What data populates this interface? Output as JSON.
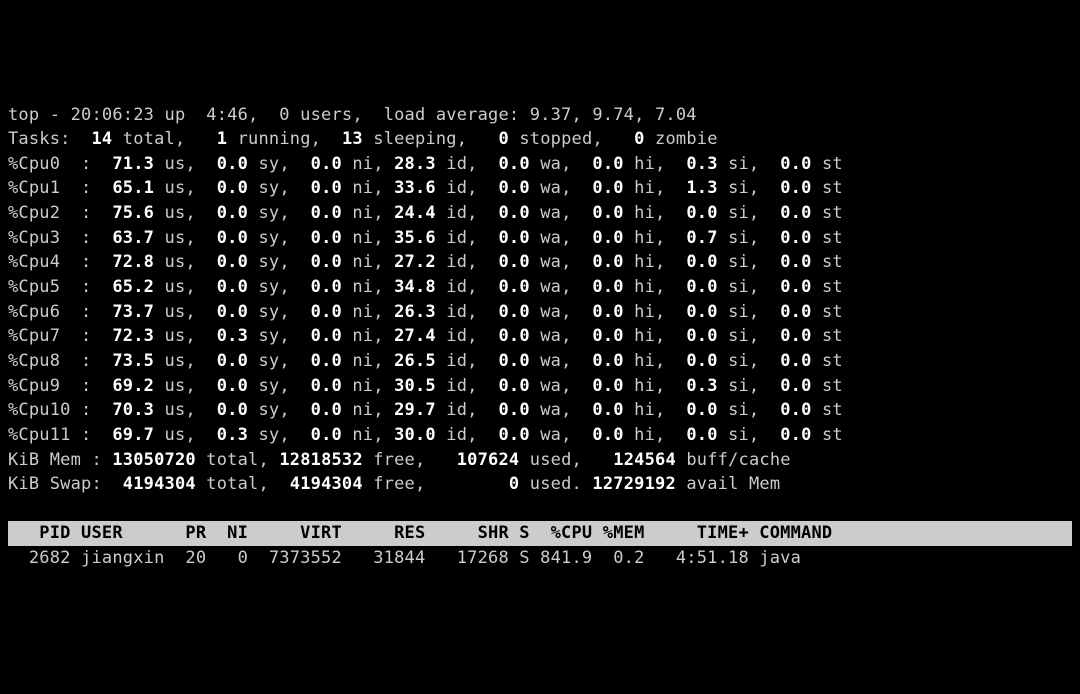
{
  "summary": {
    "program": "top",
    "time": "20:06:23",
    "up": "4:46",
    "users": "0",
    "load": [
      "9.37",
      "9.74",
      "7.04"
    ]
  },
  "tasks": {
    "total": "14",
    "running": "1",
    "sleeping": "13",
    "stopped": "0",
    "zombie": "0"
  },
  "cpu": [
    {
      "n": "0",
      "us": "71.3",
      "sy": "0.0",
      "ni": "0.0",
      "id": "28.3",
      "wa": "0.0",
      "hi": "0.0",
      "si": "0.3",
      "st": "0.0"
    },
    {
      "n": "1",
      "us": "65.1",
      "sy": "0.0",
      "ni": "0.0",
      "id": "33.6",
      "wa": "0.0",
      "hi": "0.0",
      "si": "1.3",
      "st": "0.0"
    },
    {
      "n": "2",
      "us": "75.6",
      "sy": "0.0",
      "ni": "0.0",
      "id": "24.4",
      "wa": "0.0",
      "hi": "0.0",
      "si": "0.0",
      "st": "0.0"
    },
    {
      "n": "3",
      "us": "63.7",
      "sy": "0.0",
      "ni": "0.0",
      "id": "35.6",
      "wa": "0.0",
      "hi": "0.0",
      "si": "0.7",
      "st": "0.0"
    },
    {
      "n": "4",
      "us": "72.8",
      "sy": "0.0",
      "ni": "0.0",
      "id": "27.2",
      "wa": "0.0",
      "hi": "0.0",
      "si": "0.0",
      "st": "0.0"
    },
    {
      "n": "5",
      "us": "65.2",
      "sy": "0.0",
      "ni": "0.0",
      "id": "34.8",
      "wa": "0.0",
      "hi": "0.0",
      "si": "0.0",
      "st": "0.0"
    },
    {
      "n": "6",
      "us": "73.7",
      "sy": "0.0",
      "ni": "0.0",
      "id": "26.3",
      "wa": "0.0",
      "hi": "0.0",
      "si": "0.0",
      "st": "0.0"
    },
    {
      "n": "7",
      "us": "72.3",
      "sy": "0.3",
      "ni": "0.0",
      "id": "27.4",
      "wa": "0.0",
      "hi": "0.0",
      "si": "0.0",
      "st": "0.0"
    },
    {
      "n": "8",
      "us": "73.5",
      "sy": "0.0",
      "ni": "0.0",
      "id": "26.5",
      "wa": "0.0",
      "hi": "0.0",
      "si": "0.0",
      "st": "0.0"
    },
    {
      "n": "9",
      "us": "69.2",
      "sy": "0.0",
      "ni": "0.0",
      "id": "30.5",
      "wa": "0.0",
      "hi": "0.0",
      "si": "0.3",
      "st": "0.0"
    },
    {
      "n": "10",
      "us": "70.3",
      "sy": "0.0",
      "ni": "0.0",
      "id": "29.7",
      "wa": "0.0",
      "hi": "0.0",
      "si": "0.0",
      "st": "0.0"
    },
    {
      "n": "11",
      "us": "69.7",
      "sy": "0.3",
      "ni": "0.0",
      "id": "30.0",
      "wa": "0.0",
      "hi": "0.0",
      "si": "0.0",
      "st": "0.0"
    }
  ],
  "mem": {
    "total": "13050720",
    "free": "12818532",
    "used": "107624",
    "buff": "124564"
  },
  "swap": {
    "total": "4194304",
    "free": "4194304",
    "used": "0",
    "avail": "12729192"
  },
  "columns": [
    "PID",
    "USER",
    "PR",
    "NI",
    "VIRT",
    "RES",
    "SHR",
    "S",
    "%CPU",
    "%MEM",
    "TIME+",
    "COMMAND"
  ],
  "procs": [
    {
      "pid": "2682",
      "user": "jiangxin",
      "pr": "20",
      "ni": "0",
      "virt": "7373552",
      "res": "31844",
      "shr": "17268",
      "s": "S",
      "cpu": "841.9",
      "mem": "0.2",
      "time": "4:51.18",
      "cmd": "java"
    }
  ]
}
